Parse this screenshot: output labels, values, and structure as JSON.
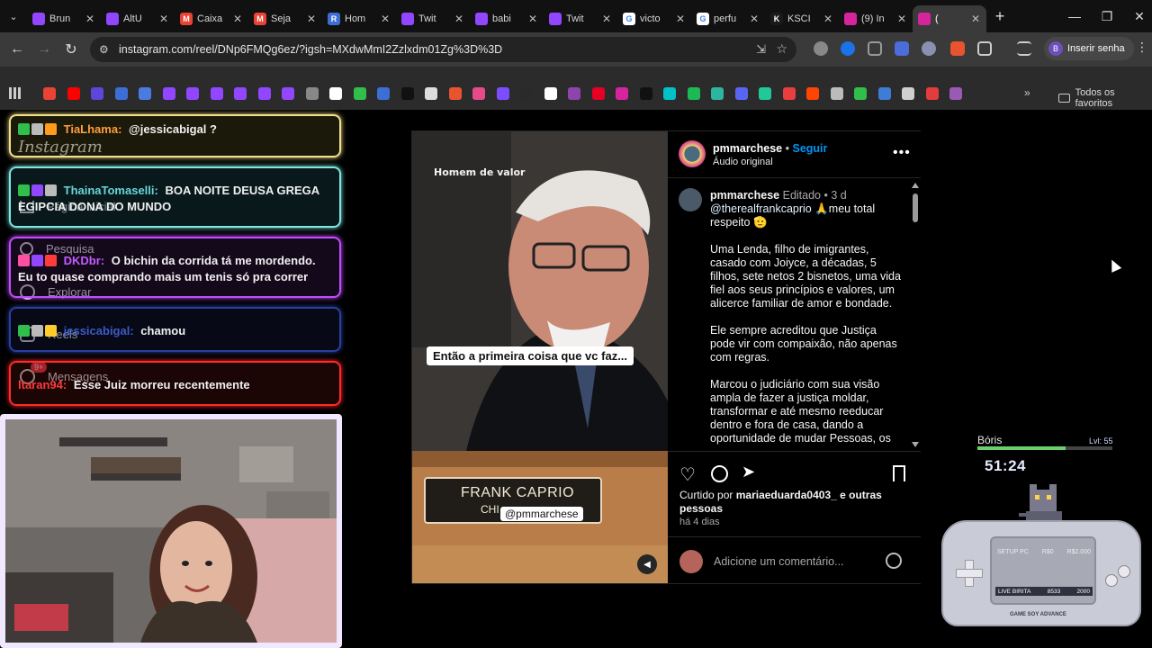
{
  "browser": {
    "tabs": [
      {
        "title": "Brun",
        "icon": "twitch-icon",
        "color": "#9146ff",
        "letter": ""
      },
      {
        "title": "AltU",
        "icon": "twitch-icon",
        "color": "#9146ff",
        "letter": ""
      },
      {
        "title": "Caixa",
        "icon": "gmail-icon",
        "color": "#ea4335",
        "letter": "M"
      },
      {
        "title": "Seja",
        "icon": "gmail-icon",
        "color": "#ea4335",
        "letter": "M"
      },
      {
        "title": "Hom",
        "icon": "r-icon",
        "color": "#3b6fd6",
        "letter": "R"
      },
      {
        "title": "Twit",
        "icon": "twitch-icon",
        "color": "#9146ff",
        "letter": ""
      },
      {
        "title": "babi",
        "icon": "twitch-icon",
        "color": "#9146ff",
        "letter": ""
      },
      {
        "title": "Twit",
        "icon": "twitch-icon",
        "color": "#9146ff",
        "letter": ""
      },
      {
        "title": "victo",
        "icon": "google-icon",
        "color": "#ffffff",
        "letter": "G"
      },
      {
        "title": "perfu",
        "icon": "google-icon",
        "color": "#ffffff",
        "letter": "G"
      },
      {
        "title": "KSCI",
        "icon": "ksci-icon",
        "color": "#1a1a1a",
        "letter": "K"
      },
      {
        "title": "(9) In",
        "icon": "instagram-icon",
        "color": "#d6249f",
        "letter": ""
      },
      {
        "title": "(",
        "icon": "instagram-icon",
        "color": "#d6249f",
        "letter": ""
      }
    ],
    "url": "instagram.com/reel/DNp6FMQg6ez/?igsh=MXdwMmI2Zzlxdm01Zg%3D%3D",
    "incognito_label": "Inserir senha",
    "incognito_avatar": "B",
    "bookmarks_all": "Todos os favoritos"
  },
  "ig_nav": {
    "logo": "Instagram",
    "home": "Página inicial",
    "search": "Pesquisa",
    "explore": "Explorar",
    "reels": "Reels",
    "messages": "Mensagens",
    "messages_badge": "9+"
  },
  "chat": [
    {
      "user": "TiaLhama:",
      "user_color": "#ff9e3d",
      "text": "@jessicabigal ?",
      "border": "#f3e08a"
    },
    {
      "user": "ThainaTomaselli:",
      "user_color": "#69d4d9",
      "text": "BOA NOITE DEUSA GREGA EGIPCIA DONA DO MUNDO",
      "border": "#7fe6e0"
    },
    {
      "user": "DKDbr:",
      "user_color": "#c35cff",
      "text": "O bichin da corrida tá me mordendo. Eu to quase comprando mais um tenis só pra correr",
      "border": "#c04dff"
    },
    {
      "user": "jessicabigal:",
      "user_color": "#3d5bc7",
      "text": "chamou",
      "border": "#2a3f9e"
    },
    {
      "user": "ltaran94:",
      "user_color": "#ff3b3b",
      "text": "Esse Juiz morreu recentemente",
      "border": "#ff2a2a"
    }
  ],
  "post": {
    "video_overlay_brand": "Homem de valor",
    "subtitle": "Então a primeira coisa que vc faz...",
    "nameplate_name": "FRANK CAPRIO",
    "nameplate_sub": "CHI",
    "watermark": "@pmmarchese",
    "author": "pmmarchese",
    "follow": "Seguir",
    "audio": "Áudio original",
    "caption_author": "pmmarchese",
    "edited": "Editado",
    "age": "3 d",
    "mention": "@therealfrankcaprio",
    "caption_line1_rest": "🙏meu total respeito 🫡",
    "para1": "Uma Lenda, filho de imigrantes, casado com Joiyce, a décadas, 5 filhos, sete netos 2 bisnetos, uma vida fiel aos seus princípios e valores, um alicerce familiar de amor e bondade.",
    "para2": "Ele sempre acreditou que Justiça pode vir com compaixão, não apenas com regras.",
    "para3": "Marcou o judiciário com sua visão ampla de fazer a justiça moldar, transformar e até mesmo reeducar dentro e fora de casa, dando a oportunidade de mudar Pessoas, os",
    "liked_prefix": "Curtido por",
    "liked_user": "mariaeduarda0403_",
    "liked_suffix": "e outras pessoas",
    "posted": "há 4 dias",
    "comment_placeholder": "Adicione um comentário..."
  },
  "stream_widgets": {
    "pet_name": "Bóris",
    "pet_level": "Lvl: 55",
    "pet_xp_fraction": 0.65,
    "timer": "51:24",
    "gba_line1_left": "SETUP PC",
    "gba_line1_mid": "R$0",
    "gba_line1_right": "R$2.000",
    "gba_line2_left": "LIVE BIRITA",
    "gba_line2_mid": "8533",
    "gba_line2_right": "2000",
    "gba_brand": "GAME SOY ADVANCE"
  }
}
